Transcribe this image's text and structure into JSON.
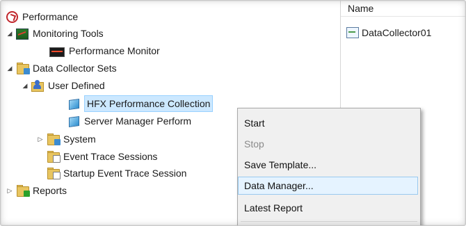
{
  "tree": {
    "root": "Performance",
    "monitoring_tools": "Monitoring Tools",
    "performance_monitor": "Performance Monitor",
    "data_collector_sets": "Data Collector Sets",
    "user_defined": "User Defined",
    "hfx_collection": "HFX Performance Collection",
    "server_manager": "Server Manager Perform",
    "system": "System",
    "event_trace": "Event Trace Sessions",
    "startup_trace": "Startup Event Trace Session",
    "reports": "Reports"
  },
  "list": {
    "column_name": "Name",
    "items": [
      "DataCollector01"
    ]
  },
  "context_menu": {
    "items": [
      {
        "label": "Start",
        "enabled": true
      },
      {
        "label": "Stop",
        "enabled": false
      },
      {
        "label": "Save Template...",
        "enabled": true
      },
      {
        "label": "Data Manager...",
        "enabled": true,
        "highlighted": true
      },
      {
        "label": "Latest Report",
        "enabled": true
      }
    ]
  },
  "colors": {
    "selection_bg": "#cce8ff",
    "menu_hover_bg": "#e5f3ff",
    "menu_bg": "#f0f0f0",
    "folder": "#e8c560"
  }
}
